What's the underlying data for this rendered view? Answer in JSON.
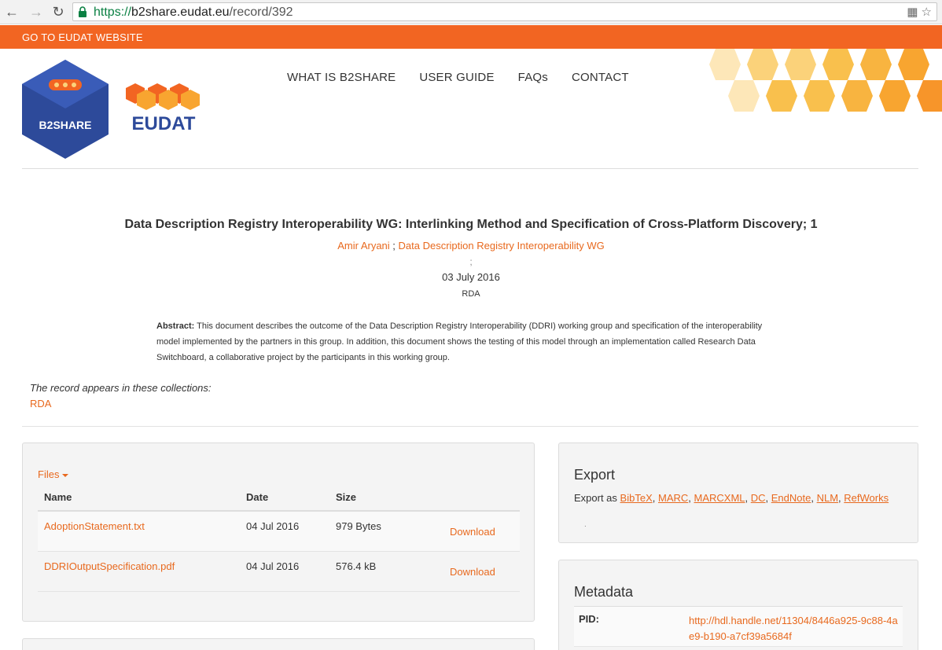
{
  "browser": {
    "url_scheme": "https://",
    "url_host": "b2share.eudat.eu",
    "url_path": "/record/392"
  },
  "topbar": {
    "link": "GO TO EUDAT WEBSITE"
  },
  "brand": {
    "b2share_label": "B2SHARE",
    "eudat_label": "EUDAT"
  },
  "nav": {
    "items": [
      "WHAT IS B2SHARE",
      "USER GUIDE",
      "FAQs",
      "CONTACT"
    ]
  },
  "record": {
    "title": "Data Description Registry Interoperability WG: Interlinking Method and Specification of Cross-Platform Discovery; 1",
    "authors": [
      "Amir Aryani",
      "Data Description Registry Interoperability WG"
    ],
    "author_sep": " ; ",
    "semicolon": ";",
    "date": "03 July 2016",
    "publisher": "RDA",
    "abstract_label": "Abstract:",
    "abstract": "This document describes the outcome of the Data Description Registry Interoperability (DDRI) working group and specification of the interoperability model implemented by the partners in this group. In addition, this document shows the testing of this model through an implementation called Research Data Switchboard, a collaborative project by the participants in this working group.",
    "collections_label": "The record appears in these collections:",
    "collection": "RDA"
  },
  "files": {
    "toggle": "Files",
    "headers": [
      "Name",
      "Date",
      "Size"
    ],
    "rows": [
      {
        "name": "AdoptionStatement.txt",
        "date": "04 Jul 2016",
        "size": "979 Bytes",
        "action": "Download"
      },
      {
        "name": "DDRIOutputSpecification.pdf",
        "date": "04 Jul 2016",
        "size": "576.4 kB",
        "action": "Download"
      }
    ]
  },
  "export": {
    "title": "Export",
    "prefix": "Export as",
    "formats": [
      "BibTeX",
      "MARC",
      "MARCXML",
      "DC",
      "EndNote",
      "NLM",
      "RefWorks"
    ],
    "trailing": "."
  },
  "metadata": {
    "title": "Metadata",
    "pid_label": "PID:",
    "pid_value": "http://hdl.handle.net/11304/8446a925-9c88-4ae9-b190-a7cf39a5684f"
  },
  "colors": {
    "accent": "#f26522",
    "link": "#e8691e",
    "hex_light": "#fbd27a",
    "hex_dark": "#f8a530",
    "b2share_blue": "#2d4a9a"
  }
}
